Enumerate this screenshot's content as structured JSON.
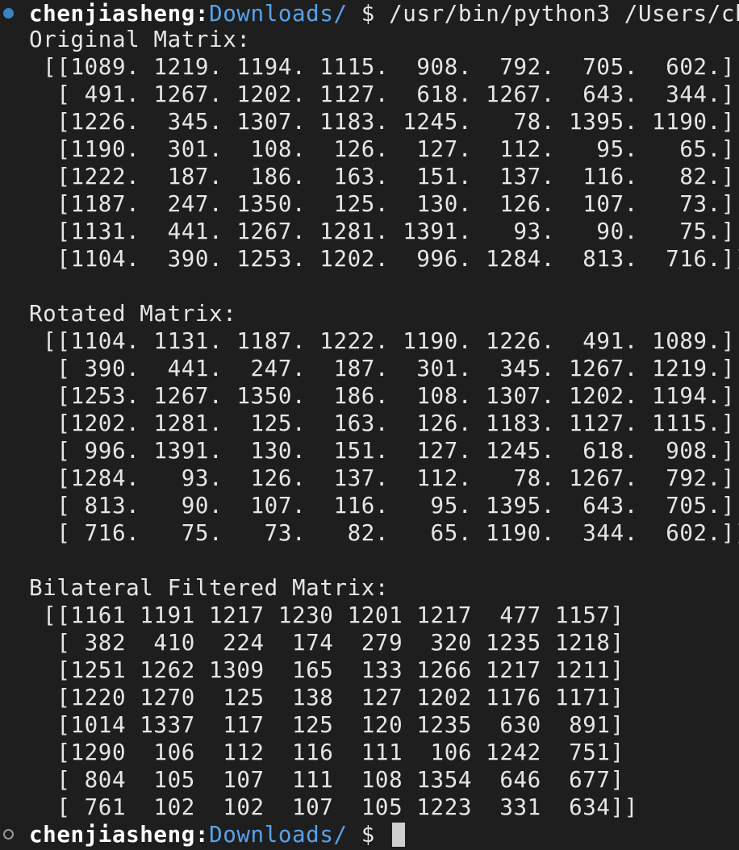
{
  "prompt": {
    "user": "chenjiasheng",
    "sep": ":",
    "dir": "Downloads/",
    "symbol": " $ ",
    "command": "/usr/bin/python3 /Users/ch"
  },
  "output": {
    "original": {
      "title": "Original Matrix:",
      "rows": [
        " [[1089. 1219. 1194. 1115.  908.  792.  705.  602.]",
        "  [ 491. 1267. 1202. 1127.  618. 1267.  643.  344.]",
        "  [1226.  345. 1307. 1183. 1245.   78. 1395. 1190.]",
        "  [1190.  301.  108.  126.  127.  112.   95.   65.]",
        "  [1222.  187.  186.  163.  151.  137.  116.   82.]",
        "  [1187.  247. 1350.  125.  130.  126.  107.   73.]",
        "  [1131.  441. 1267. 1281. 1391.   93.   90.   75.]",
        "  [1104.  390. 1253. 1202.  996. 1284.  813.  716.]]"
      ]
    },
    "rotated": {
      "title": "Rotated Matrix:",
      "rows": [
        " [[1104. 1131. 1187. 1222. 1190. 1226.  491. 1089.]",
        "  [ 390.  441.  247.  187.  301.  345. 1267. 1219.]",
        "  [1253. 1267. 1350.  186.  108. 1307. 1202. 1194.]",
        "  [1202. 1281.  125.  163.  126. 1183. 1127. 1115.]",
        "  [ 996. 1391.  130.  151.  127. 1245.  618.  908.]",
        "  [1284.   93.  126.  137.  112.   78. 1267.  792.]",
        "  [ 813.   90.  107.  116.   95. 1395.  643.  705.]",
        "  [ 716.   75.   73.   82.   65. 1190.  344.  602.]]"
      ]
    },
    "filtered": {
      "title": "Bilateral Filtered Matrix:",
      "rows": [
        " [[1161 1191 1217 1230 1201 1217  477 1157]",
        "  [ 382  410  224  174  279  320 1235 1218]",
        "  [1251 1262 1309  165  133 1266 1217 1211]",
        "  [1220 1270  125  138  127 1202 1176 1171]",
        "  [1014 1337  117  125  120 1235  630  891]",
        "  [1290  106  112  116  111  106 1242  751]",
        "  [ 804  105  107  111  108 1354  646  677]",
        "  [ 761  102  102  107  105 1223  331  634]]"
      ]
    }
  },
  "colors": {
    "background": "#1e1e1e",
    "text": "#e6e6e6",
    "directory": "#5aa2ea",
    "marker_success": "#3b82c4",
    "cursor": "#cfcfcf"
  }
}
